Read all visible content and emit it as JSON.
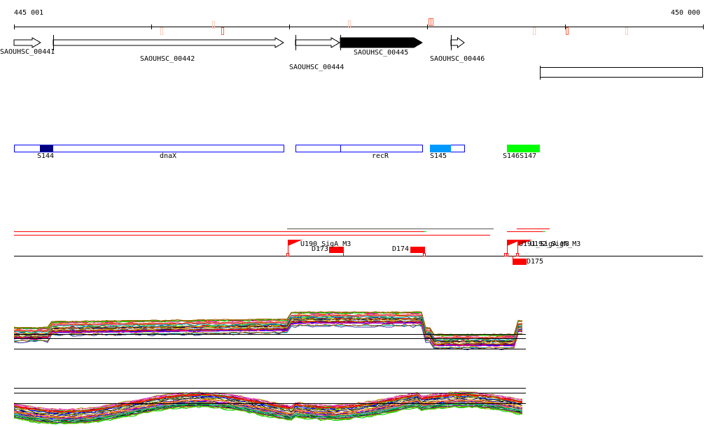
{
  "ruler": {
    "start_label": "445 001",
    "end_label": "450 000"
  },
  "genes": [
    {
      "id": "SAOUHSC_00441",
      "style": "open"
    },
    {
      "id": "SAOUHSC_00442",
      "style": "open"
    },
    {
      "id": "SAOUHSC_00444",
      "style": "open"
    },
    {
      "id": "SAOUHSC_00445",
      "style": "filled"
    },
    {
      "id": "SAOUHSC_00446",
      "style": "open"
    }
  ],
  "features": [
    {
      "label": "S144",
      "color": "#000080"
    },
    {
      "label": "dnaX",
      "color": "#0000ff"
    },
    {
      "label": "recR",
      "color": "#0000ff"
    },
    {
      "label": "S145",
      "color": "#0099ff"
    },
    {
      "label": "S146S147",
      "color": "#00ff00"
    }
  ],
  "promoters": [
    {
      "label": "U190_SigA_M3"
    },
    {
      "label": "U191_SigA_M3"
    },
    {
      "label": "U192_SigA_M3"
    }
  ],
  "terminators": [
    {
      "label": "D173"
    },
    {
      "label": "D174"
    },
    {
      "label": "D175"
    }
  ],
  "colors": {
    "accent": "#ff0000",
    "marker": "#ff6644",
    "marker_light": "#ffccbb",
    "gene_fill": "#000000"
  }
}
